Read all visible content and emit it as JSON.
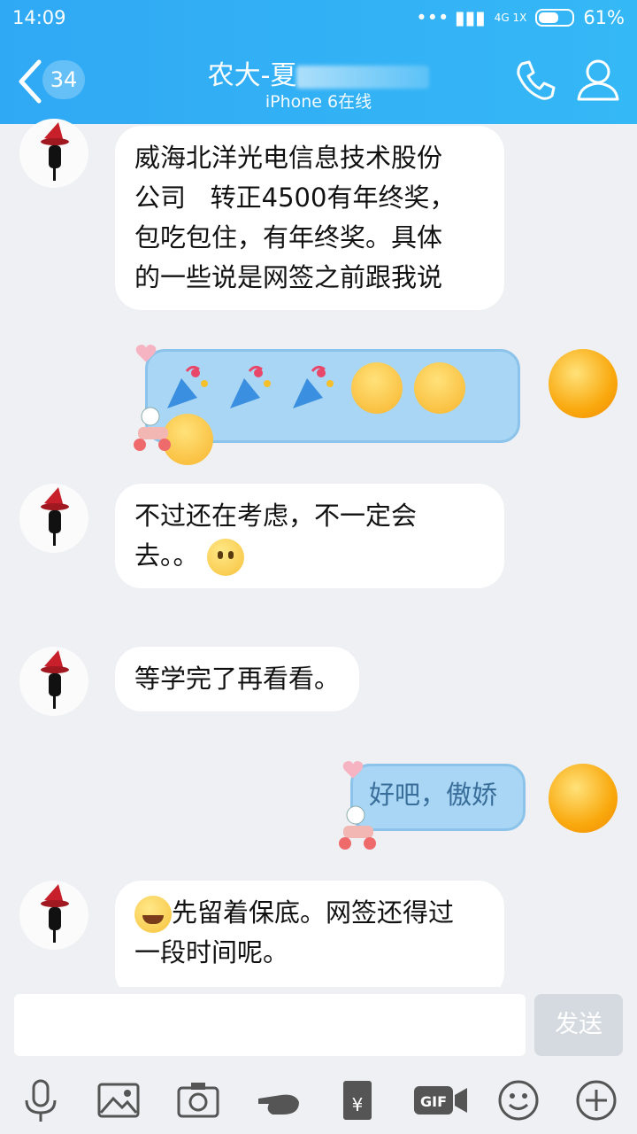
{
  "status_bar": {
    "time": "14:09",
    "network": "4G 1X",
    "battery": "61%",
    "battery_level": 0.61
  },
  "header": {
    "unread_count": "34",
    "title": "农大-夏",
    "subtitle": "iPhone 6在线"
  },
  "messages": [
    {
      "side": "left",
      "text_lines": [
        "威海北洋光电信息技术股份",
        "公司   转正4500有年终奖，",
        "包吃包住，有年终奖。具体",
        "的一些说是网签之前跟我说"
      ]
    },
    {
      "side": "right",
      "emojis": [
        "party-popper",
        "party-popper",
        "party-popper",
        "shy-face",
        "shy-face",
        "shy-face"
      ]
    },
    {
      "side": "left",
      "text_lines": [
        "不过还在考虑，不一定会",
        "去。。"
      ],
      "trailing_emoji": "hushed-face"
    },
    {
      "side": "left",
      "text_lines": [
        "等学完了再看看。"
      ]
    },
    {
      "side": "right",
      "text_lines": [
        "好吧，傲娇"
      ]
    },
    {
      "side": "left",
      "leading_emoji": "tears-of-joy-face",
      "text_lines": [
        "先留着保底。网签还得过",
        "一段时间呢。"
      ]
    }
  ],
  "input": {
    "placeholder": "",
    "send_label": "发送"
  },
  "toolbar": [
    "microphone-icon",
    "image-icon",
    "camera-icon",
    "poke-icon",
    "red-packet-icon",
    "gif-icon",
    "emoji-icon",
    "plus-icon"
  ],
  "colors": {
    "header": "#30a9f4",
    "right_bubble": "#a9d6f4",
    "left_bubble": "#ffffff"
  }
}
